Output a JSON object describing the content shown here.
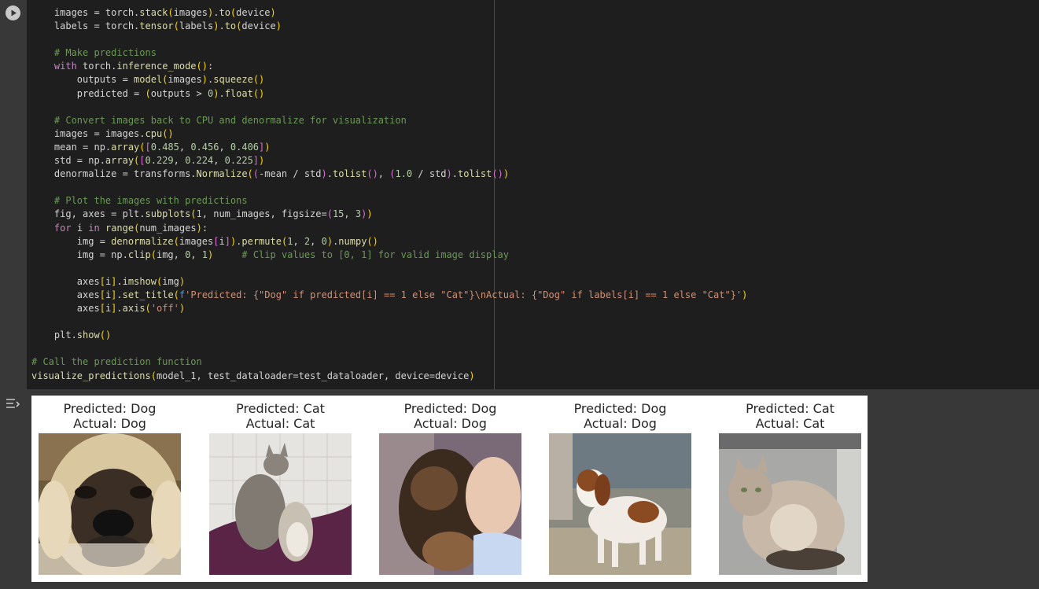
{
  "code_cell": {
    "run_label": "Run cell",
    "lines": [
      "    images = torch.stack(images).to(device)",
      "    labels = torch.tensor(labels).to(device)",
      "",
      "    # Make predictions",
      "    with torch.inference_mode():",
      "        outputs = model(images).squeeze()",
      "        predicted = (outputs > 0).float()",
      "",
      "    # Convert images back to CPU and denormalize for visualization",
      "    images = images.cpu()",
      "    mean = np.array([0.485, 0.456, 0.406])",
      "    std = np.array([0.229, 0.224, 0.225])",
      "    denormalize = transforms.Normalize((-mean / std).tolist(), (1.0 / std).tolist())",
      "",
      "    # Plot the images with predictions",
      "    fig, axes = plt.subplots(1, num_images, figsize=(15, 3))",
      "    for i in range(num_images):",
      "        img = denormalize(images[i]).permute(1, 2, 0).numpy()",
      "        img = np.clip(img, 0, 1)     # Clip values to [0, 1] for valid image display",
      "",
      "        axes[i].imshow(img)",
      "        axes[i].set_title(f'Predicted: {\"Dog\" if predicted[i] == 1 else \"Cat\"}\\nActual: {\"Dog\" if labels[i] == 1 else \"Cat\"}')",
      "        axes[i].axis('off')",
      "",
      "    plt.show()",
      "",
      "# Call the prediction function",
      "visualize_predictions(model_1, test_dataloader=test_dataloader, device=device)"
    ]
  },
  "output": {
    "icon": "output-toggle-icon",
    "panels": [
      {
        "predicted": "Predicted: Dog",
        "actual": "Actual: Dog",
        "image": "mastiff dog closeup photo"
      },
      {
        "predicted": "Predicted: Cat",
        "actual": "Actual: Cat",
        "image": "two cats on purple blanket photo"
      },
      {
        "predicted": "Predicted: Dog",
        "actual": "Actual: Dog",
        "image": "puppy with child photo"
      },
      {
        "predicted": "Predicted: Dog",
        "actual": "Actual: Dog",
        "image": "beagle on gravel photo"
      },
      {
        "predicted": "Predicted: Cat",
        "actual": "Actual: Cat",
        "image": "fluffy cat in box photo"
      }
    ]
  },
  "colors": {
    "editor_bg": "#1e1e1e",
    "page_bg": "#383838",
    "keyword": "#c586c0",
    "function": "#dcdcaa",
    "number": "#b5cea8",
    "string": "#ce9178",
    "comment": "#6a9955"
  }
}
